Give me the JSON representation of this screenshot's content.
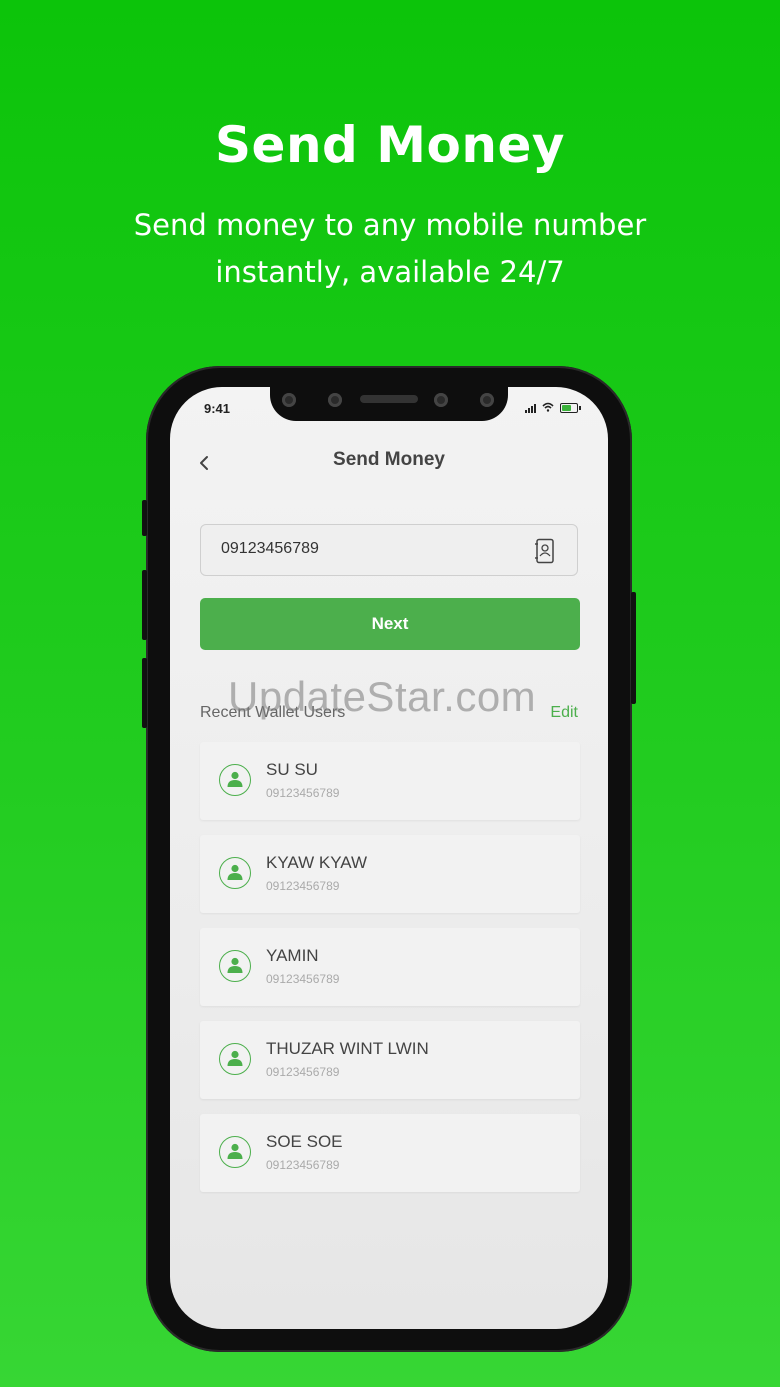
{
  "hero": {
    "title": "Send Money",
    "subtitle_line1": "Send money to any mobile number",
    "subtitle_line2": "instantly, available 24/7"
  },
  "status_bar": {
    "time": "9:41"
  },
  "screen": {
    "title": "Send Money",
    "back_icon": "chevron-left-icon",
    "phone_input_value": "09123456789",
    "next_label": "Next",
    "recent_label": "Recent Wallet Users",
    "edit_label": "Edit"
  },
  "watermark": "UpdateStar.com",
  "users": [
    {
      "name": "SU SU",
      "phone": "09123456789"
    },
    {
      "name": "KYAW KYAW",
      "phone": "09123456789"
    },
    {
      "name": "YAMIN",
      "phone": "09123456789"
    },
    {
      "name": "THUZAR WINT LWIN",
      "phone": "09123456789"
    },
    {
      "name": "SOE SOE",
      "phone": "09123456789"
    }
  ],
  "colors": {
    "background_green": "#0cc40a",
    "accent_green": "#4caf4c",
    "phone_frame": "#0e0e0e"
  }
}
